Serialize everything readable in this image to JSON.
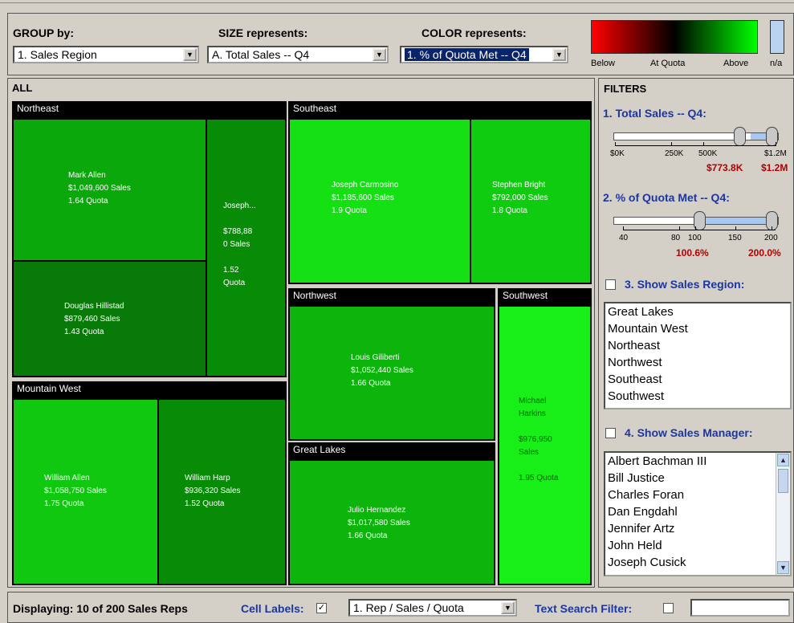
{
  "toolbar": {
    "group_label": "GROUP by:",
    "group_value": "1. Sales Region",
    "size_label": "SIZE represents:",
    "size_value": "A. Total Sales -- Q4",
    "color_label": "COLOR represents:",
    "color_value": "1. % of Quota Met -- Q4",
    "legend": {
      "below": "Below",
      "at_quota": "At Quota",
      "above": "Above",
      "na": "n/a",
      "colors": [
        "#ff0000",
        "#000000",
        "#00ff00"
      ],
      "na_color": "#b9d3f0"
    }
  },
  "treemap": {
    "root_label": "ALL",
    "groups": [
      {
        "name": "Northeast",
        "cells": [
          {
            "lines": [
              "Mark Allen",
              "$1,049,600 Sales",
              "1.64 Quota"
            ],
            "color": "#0aa80a"
          },
          {
            "lines": [
              "Douglas Hillistad",
              "$879,460 Sales",
              "1.43 Quota"
            ],
            "color": "#087a08"
          },
          {
            "lines": [
              "Joseph...",
              "",
              "$788,88",
              "0 Sales",
              "",
              "1.52",
              "Quota"
            ],
            "color": "#088c08"
          }
        ]
      },
      {
        "name": "Southeast",
        "cells": [
          {
            "lines": [
              "Joseph Carmosino",
              "$1,185,600 Sales",
              "1.9 Quota"
            ],
            "color": "#14e014"
          },
          {
            "lines": [
              "Stephen Bright",
              "$792,000 Sales",
              "1.8 Quota"
            ],
            "color": "#10cc10"
          }
        ]
      },
      {
        "name": "Mountain West",
        "cells": [
          {
            "lines": [
              "William Allen",
              "$1,058,750 Sales",
              "1.75 Quota"
            ],
            "color": "#10c810"
          },
          {
            "lines": [
              "William Harp",
              "$936,320 Sales",
              "1.52 Quota"
            ],
            "color": "#088c08"
          }
        ]
      },
      {
        "name": "Northwest",
        "cells": [
          {
            "lines": [
              "Louis Giliberti",
              "$1,052,440 Sales",
              "1.66 Quota"
            ],
            "color": "#0cb40c"
          }
        ]
      },
      {
        "name": "Southwest",
        "cells": [
          {
            "lines": [
              "Michael",
              "Harkins",
              "",
              "$976,950",
              "Sales",
              "",
              "1.95 Quota"
            ],
            "color": "#18ee18"
          }
        ]
      },
      {
        "name": "Great Lakes",
        "cells": [
          {
            "lines": [
              "Julio Hernandez",
              "$1,017,580 Sales",
              "1.66 Quota"
            ],
            "color": "#0cb40c"
          }
        ]
      }
    ]
  },
  "filters": {
    "title": "FILTERS",
    "sales_filter": {
      "title": "1. Total Sales -- Q4:",
      "ticks": [
        "$0K",
        "250K",
        "500K",
        "$1.2M"
      ],
      "low": "$773.8K",
      "high": "$1.2M"
    },
    "quota_filter": {
      "title": "2. % of Quota Met -- Q4:",
      "ticks": [
        "40",
        "80",
        "100",
        "150",
        "200"
      ],
      "low": "100.6%",
      "high": "200.0%"
    },
    "region_filter": {
      "title": "3. Show Sales Region:",
      "checked": false,
      "items": [
        "Great Lakes",
        "Mountain West",
        "Northeast",
        "Northwest",
        "Southeast",
        "Southwest"
      ]
    },
    "manager_filter": {
      "title": "4. Show Sales Manager:",
      "checked": false,
      "items": [
        "Albert Bachman III",
        "Bill Justice",
        "Charles Foran",
        "Dan Engdahl",
        "Jennifer Artz",
        "John Held",
        "Joseph Cusick"
      ]
    }
  },
  "status": {
    "displaying": "Displaying: 10 of 200 Sales Reps",
    "cell_labels_label": "Cell Labels:",
    "cell_labels_checked": true,
    "cell_labels_value": "1. Rep / Sales / Quota",
    "text_search_label": "Text Search Filter:",
    "text_search_checked": false,
    "text_search_value": ""
  }
}
